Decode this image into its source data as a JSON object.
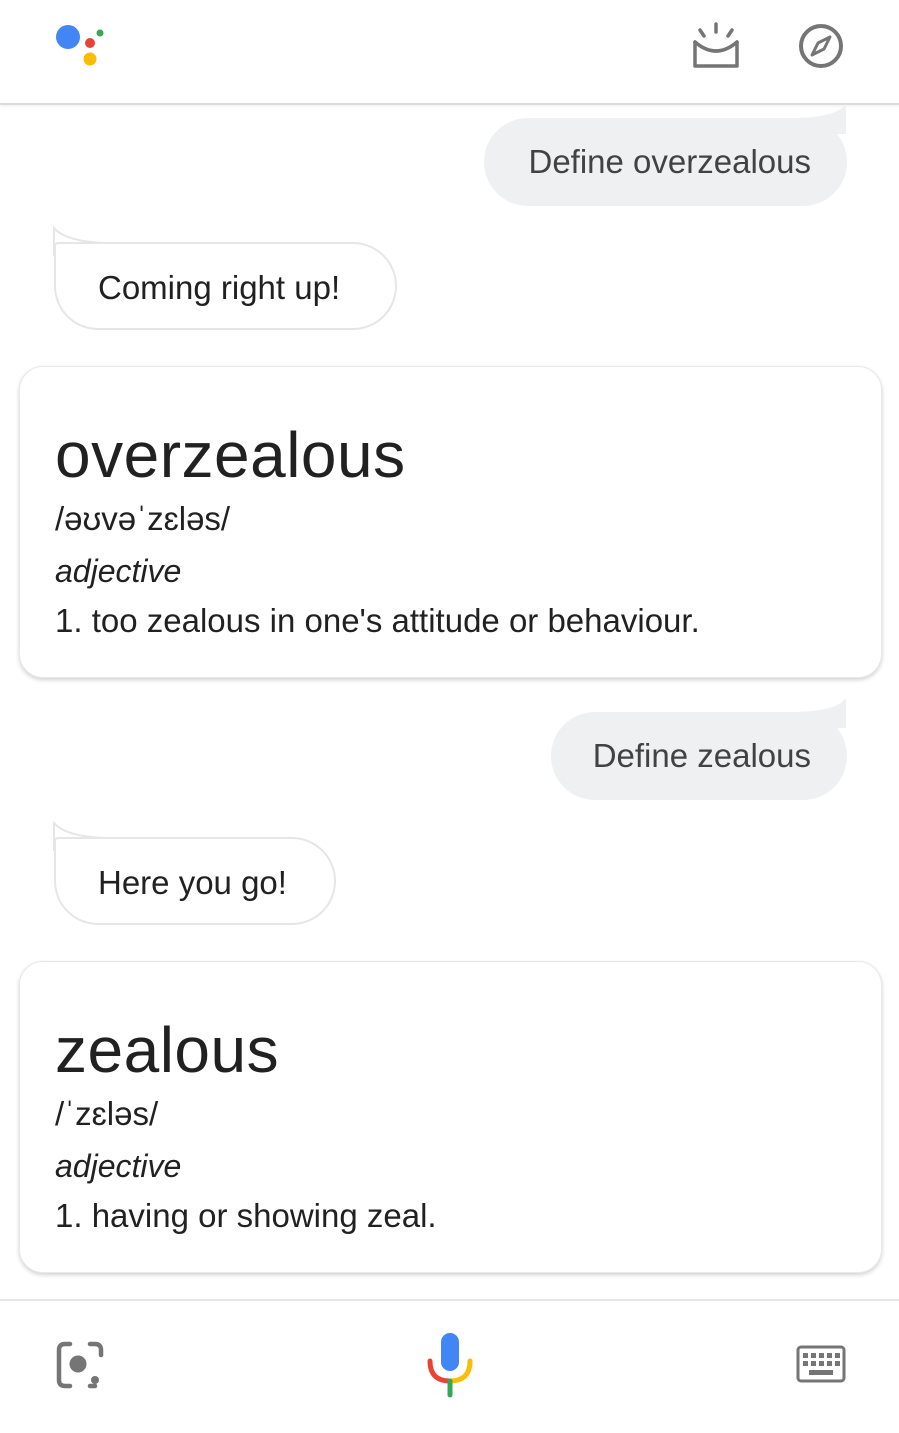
{
  "header": {
    "logo_icon": "google-assistant-logo",
    "snapshot_icon": "snapshot-icon",
    "explore_icon": "explore-compass-icon"
  },
  "conversation": {
    "query_1": "Define overzealous",
    "reply_1": "Coming right up!",
    "card_1": {
      "word": "overzealous",
      "pronunciation": "/əʊvəˈzɛləs/",
      "part_of_speech": "adjective",
      "definition": "1. too zealous in one's attitude or behaviour."
    },
    "query_2": "Define zealous",
    "reply_2": "Here you go!",
    "card_2": {
      "word": "zealous",
      "pronunciation": "/ˈzɛləs/",
      "part_of_speech": "adjective",
      "definition": "1. having or showing zeal."
    }
  },
  "footer": {
    "lens_icon": "google-lens-icon",
    "mic_icon": "microphone-icon",
    "keyboard_icon": "keyboard-icon"
  },
  "colors": {
    "blue": "#4285F4",
    "red": "#EA4335",
    "yellow": "#FBBC05",
    "green": "#34A853",
    "icon_gray": "#757575",
    "user_bubble_bg": "#eef0f2"
  }
}
